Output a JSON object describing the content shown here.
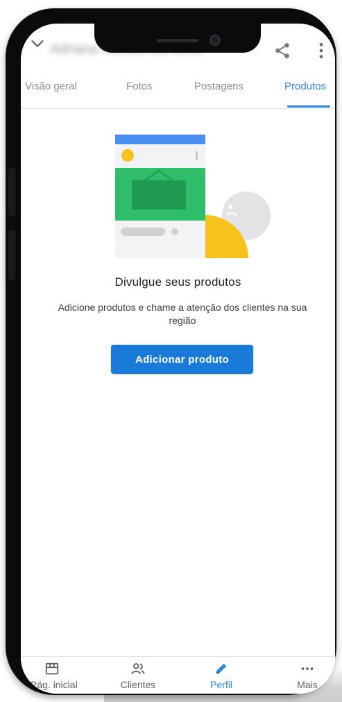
{
  "app": {
    "title": "Adriana Moraes da Silva"
  },
  "tabs": [
    {
      "label": "Visão geral",
      "active": false
    },
    {
      "label": "Fotos",
      "active": false
    },
    {
      "label": "Postagens",
      "active": false
    },
    {
      "label": "Produtos",
      "active": true
    }
  ],
  "empty_state": {
    "heading": "Divulgue seus produtos",
    "description": "Adicione produtos e chame a atenção dos clientes na sua região",
    "button_label": "Adicionar produto",
    "illustration_icon": "product-listing-illustration"
  },
  "bottom_nav": [
    {
      "label": "Pág. inicial",
      "icon": "storefront-icon",
      "active": false
    },
    {
      "label": "Clientes",
      "icon": "people-icon",
      "active": false
    },
    {
      "label": "Perfil",
      "icon": "pencil-icon",
      "active": true
    },
    {
      "label": "Mais",
      "icon": "more-horiz-icon",
      "active": false
    }
  ],
  "colors": {
    "accent": "#2a86e0",
    "button": "#1a7ad9",
    "illustration_green": "#2fbd6a",
    "illustration_yellow": "#f7c21b",
    "illustration_blue": "#4a8ff0"
  }
}
